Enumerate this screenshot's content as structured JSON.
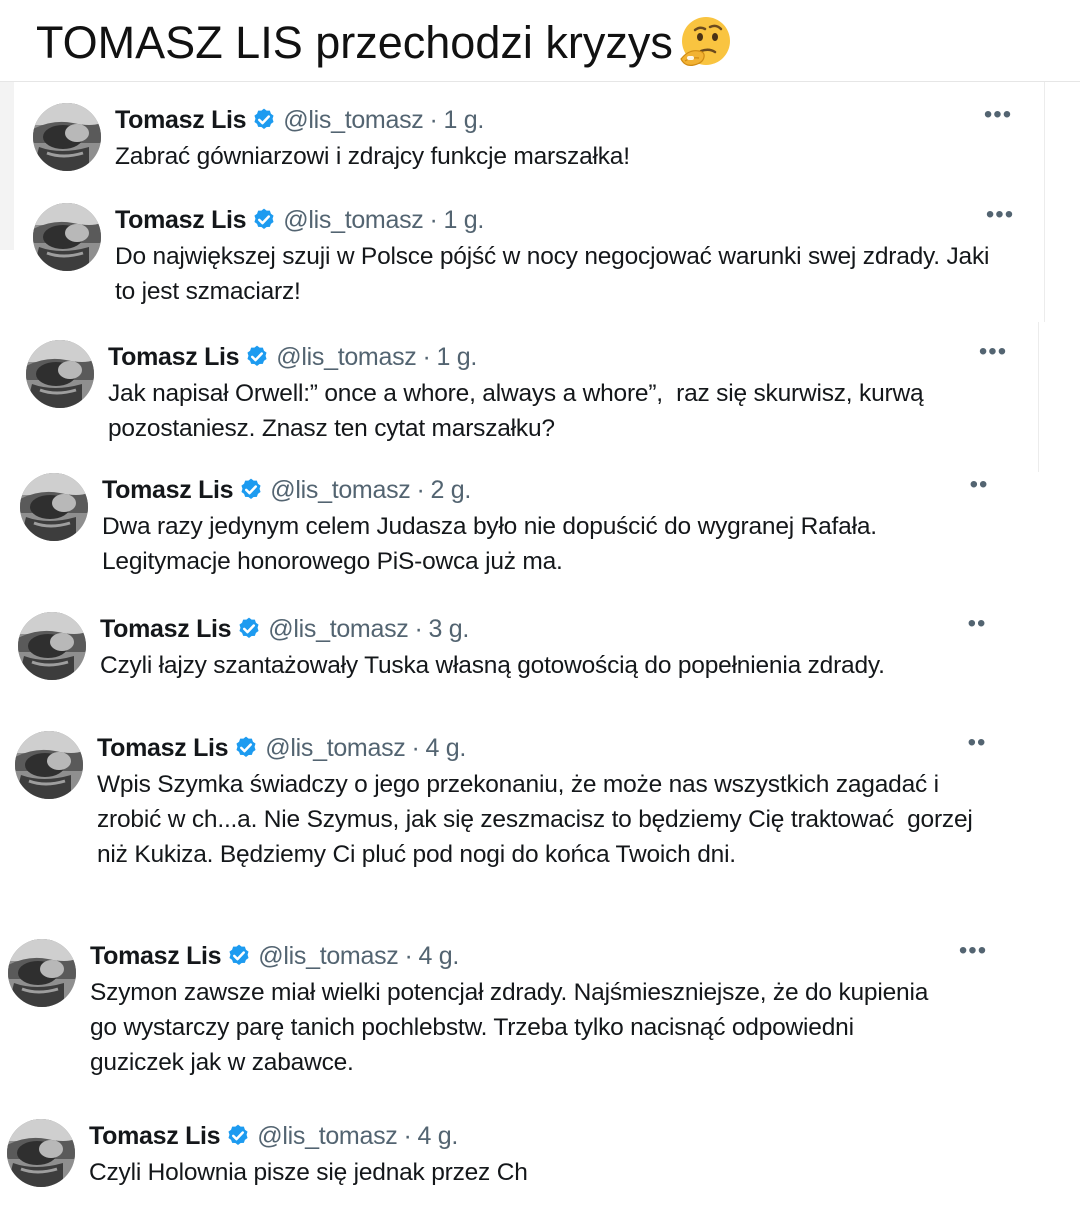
{
  "headline": "TOMASZ LIS przechodzi kryzys",
  "headline_emoji": "thinking-face-icon",
  "colors": {
    "verified": "#1d9bf0",
    "name": "#14171a",
    "meta": "#536471"
  },
  "tweets": [
    {
      "name": "Tomasz Lis",
      "handle": "@lis_tomasz",
      "dot": "·",
      "time": "1 g.",
      "more": "•••",
      "text": "Zabrać gówniarzowi i zdrajcy funkcje marszałka!"
    },
    {
      "name": "Tomasz Lis",
      "handle": "@lis_tomasz",
      "dot": "·",
      "time": "1 g.",
      "more": "•••",
      "text": "Do największej szuji w Polsce pójść w nocy negocjować warunki swej zdrady. Jaki to jest szmaciarz!"
    },
    {
      "name": "Tomasz Lis",
      "handle": "@lis_tomasz",
      "dot": "·",
      "time": "1 g.",
      "more": "•••",
      "text": "Jak napisał Orwell:” once a whore, always a whore”,  raz się skurwisz, kurwą pozostaniesz. Znasz ten cytat marszałku?"
    },
    {
      "name": "Tomasz Lis",
      "handle": "@lis_tomasz",
      "dot": "·",
      "time": "2 g.",
      "more": "••",
      "text": "Dwa razy jedynym celem Judasza było nie dopuścić do wygranej Rafała. Legitymacje honorowego PiS-owca już ma."
    },
    {
      "name": "Tomasz Lis",
      "handle": "@lis_tomasz",
      "dot": "·",
      "time": "3 g.",
      "more": "••",
      "text": "Czyli łajzy szantażowały Tuska własną gotowością do popełnienia zdrady."
    },
    {
      "name": "Tomasz Lis",
      "handle": "@lis_tomasz",
      "dot": "·",
      "time": "4 g.",
      "more": "••",
      "text": "Wpis Szymka świadczy o jego przekonaniu, że może nas wszystkich zagadać i zrobić w ch...a. Nie Szymus, jak się zeszmacisz to będziemy Cię traktować  gorzej niż Kukiza. Będziemy Ci pluć pod nogi do końca Twoich dni."
    },
    {
      "name": "Tomasz Lis",
      "handle": "@lis_tomasz",
      "dot": "·",
      "time": "4 g.",
      "more": "•••",
      "text": "Szymon zawsze miał wielki potencjał zdrady. Najśmieszniejsze, że do kupienia go wystarczy parę tanich pochlebstw. Trzeba tylko nacisnąć odpowiedni guziczek jak w zabawce."
    },
    {
      "name": "Tomasz Lis",
      "handle": "@lis_tomasz",
      "dot": "·",
      "time": "4 g.",
      "more": "",
      "text": "Czyli Holownia pisze się jednak przez Ch"
    }
  ]
}
